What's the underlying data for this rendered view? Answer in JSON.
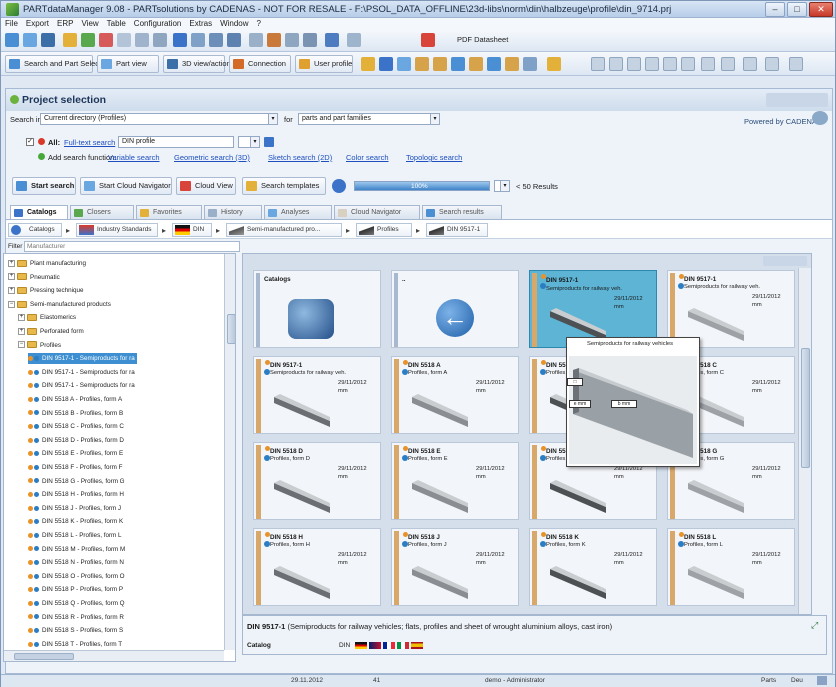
{
  "window": {
    "title": "PARTdataManager 9.08 - PARTsolutions by CADENAS - NOT FOR RESALE - F:\\PSOL_DATA_OFFLINE\\23d-libs\\norm\\din\\halbzeuge\\profile\\din_9714.prj",
    "min": "–",
    "max": "□",
    "close": "✕"
  },
  "menu": [
    "File",
    "Export",
    "ERP",
    "View",
    "Table",
    "Configuration",
    "Extras",
    "Window",
    "?"
  ],
  "toolbar2": {
    "selection": "Search and Part Selection",
    "part_view": "Part view",
    "3d_view": "3D view/action",
    "connection": "Connection",
    "user_profile": "User profile",
    "pdf": "PDF Datasheet"
  },
  "project": {
    "title": "Project selection",
    "search_in_label": "Search in",
    "search_in_value": "Current directory (Profiles)",
    "for_label": "for",
    "for_value": "parts and part families",
    "all_label": "All:",
    "fulltext_link": "Full-text search",
    "fulltext_value": "DIN profile",
    "add_search_label": "Add search function:",
    "functions": [
      "Variable search",
      "Geometric search (3D)",
      "Sketch search (2D)",
      "Color search",
      "Topologic search"
    ],
    "start_search": "Start search",
    "start_cloud": "Start Cloud Navigator",
    "cloud_view": "Cloud View",
    "search_templates": "Search templates",
    "progress_text": "100%",
    "results": "< 50 Results",
    "powerdriven": "Powered by CADENAS"
  },
  "tabs": [
    "Catalogs",
    "Closers",
    "Favorites",
    "History",
    "Analyses",
    "Cloud Navigator",
    "Search results"
  ],
  "breadcrumb": [
    "Catalogs",
    "Industry Standards",
    "DIN",
    "Semi-manufactured pro...",
    "Profiles",
    "DIN 9517-1"
  ],
  "filter": {
    "label": "Filter",
    "placeholder": "Manufacturer"
  },
  "tree": [
    {
      "label": "Plant manufacturing",
      "level": 1,
      "type": "folder",
      "exp": "+"
    },
    {
      "label": "Pneumatic",
      "level": 1,
      "type": "folder",
      "exp": "+"
    },
    {
      "label": "Pressing technique",
      "level": 1,
      "type": "folder",
      "exp": "+"
    },
    {
      "label": "Semi-manufactured products",
      "level": 1,
      "type": "folder",
      "exp": "−"
    },
    {
      "label": "Elastomerics",
      "level": 2,
      "type": "folder",
      "exp": "+"
    },
    {
      "label": "Perforated form",
      "level": 2,
      "type": "folder",
      "exp": "+"
    },
    {
      "label": "Profiles",
      "level": 2,
      "type": "folder",
      "exp": "−"
    },
    {
      "label": "DIN 9517-1 - Semiproducts for ra",
      "level": 3,
      "type": "part",
      "selected": true
    },
    {
      "label": "DIN 9517-1 - Semiproducts for ra",
      "level": 3,
      "type": "part"
    },
    {
      "label": "DIN 9517-1 - Semiproducts for ra",
      "level": 3,
      "type": "part"
    },
    {
      "label": "DIN 5518 A - Profiles, form A",
      "level": 3,
      "type": "part"
    },
    {
      "label": "DIN 5518 B - Profiles, form B",
      "level": 3,
      "type": "part"
    },
    {
      "label": "DIN 5518 C - Profiles, form C",
      "level": 3,
      "type": "part"
    },
    {
      "label": "DIN 5518 D - Profiles, form D",
      "level": 3,
      "type": "part"
    },
    {
      "label": "DIN 5518 E - Profiles, form E",
      "level": 3,
      "type": "part"
    },
    {
      "label": "DIN 5518 F - Profiles, form F",
      "level": 3,
      "type": "part"
    },
    {
      "label": "DIN 5518 G - Profiles, form G",
      "level": 3,
      "type": "part"
    },
    {
      "label": "DIN 5518 H - Profiles, form H",
      "level": 3,
      "type": "part"
    },
    {
      "label": "DIN 5518 J - Profiles, form J",
      "level": 3,
      "type": "part"
    },
    {
      "label": "DIN 5518 K - Profiles, form K",
      "level": 3,
      "type": "part"
    },
    {
      "label": "DIN 5518 L - Profiles, form L",
      "level": 3,
      "type": "part"
    },
    {
      "label": "DIN 5518 M - Profiles, form M",
      "level": 3,
      "type": "part"
    },
    {
      "label": "DIN 5518 N - Profiles, form N",
      "level": 3,
      "type": "part"
    },
    {
      "label": "DIN 5518 O - Profiles, form O",
      "level": 3,
      "type": "part"
    },
    {
      "label": "DIN 5518 P - Profiles, form P",
      "level": 3,
      "type": "part"
    },
    {
      "label": "DIN 5518 Q - Profiles, form Q",
      "level": 3,
      "type": "part"
    },
    {
      "label": "DIN 5518 R - Profiles, form R",
      "level": 3,
      "type": "part"
    },
    {
      "label": "DIN 5518 S - Profiles, form S",
      "level": 3,
      "type": "part"
    },
    {
      "label": "DIN 5518 T - Profiles, form T",
      "level": 3,
      "type": "part"
    }
  ],
  "cards": [
    {
      "title": "Catalogs",
      "desc": "",
      "date": "",
      "unit": "",
      "kind": "folder"
    },
    {
      "title": "..",
      "desc": "",
      "date": "",
      "unit": "",
      "kind": "back"
    },
    {
      "title": "DIN 9517-1",
      "desc": "Semiproducts for railway veh.",
      "date": "29/11/2012",
      "unit": "mm",
      "kind": "part",
      "selected": true
    },
    {
      "title": "DIN 9517-1",
      "desc": "Semiproducts for railway veh.",
      "date": "29/11/2012",
      "unit": "mm",
      "kind": "part"
    },
    {
      "title": "DIN 9517-1",
      "desc": "Semiproducts for railway veh.",
      "date": "29/11/2012",
      "unit": "mm",
      "kind": "part"
    },
    {
      "title": "DIN 5518 A",
      "desc": "Profiles, form A",
      "date": "29/11/2012",
      "unit": "mm",
      "kind": "part"
    },
    {
      "title": "DIN 5518 B",
      "desc": "Profiles, form B",
      "date": "29/11/2012",
      "unit": "mm",
      "kind": "part"
    },
    {
      "title": "DIN 5518 C",
      "desc": "Profiles, form C",
      "date": "29/11/2012",
      "unit": "mm",
      "kind": "part"
    },
    {
      "title": "DIN 5518 D",
      "desc": "Profiles, form D",
      "date": "29/11/2012",
      "unit": "mm",
      "kind": "part"
    },
    {
      "title": "DIN 5518 E",
      "desc": "Profiles, form E",
      "date": "29/11/2012",
      "unit": "mm",
      "kind": "part"
    },
    {
      "title": "DIN 5518 F",
      "desc": "Profiles, form F",
      "date": "29/11/2012",
      "unit": "mm",
      "kind": "part"
    },
    {
      "title": "DIN 5518 G",
      "desc": "Profiles, form G",
      "date": "29/11/2012",
      "unit": "mm",
      "kind": "part"
    },
    {
      "title": "DIN 5518 H",
      "desc": "Profiles, form H",
      "date": "29/11/2012",
      "unit": "mm",
      "kind": "part"
    },
    {
      "title": "DIN 5518 J",
      "desc": "Profiles, form J",
      "date": "29/11/2012",
      "unit": "mm",
      "kind": "part"
    },
    {
      "title": "DIN 5518 K",
      "desc": "Profiles, form K",
      "date": "29/11/2012",
      "unit": "mm",
      "kind": "part"
    },
    {
      "title": "DIN 5518 L",
      "desc": "Profiles, form L",
      "date": "29/11/2012",
      "unit": "mm",
      "kind": "part"
    }
  ],
  "tooltip": {
    "caption": "Semiproducts for railway vehicles",
    "dim1": "e mm",
    "dim2": "b mm"
  },
  "info": {
    "title": "DIN 9517-1",
    "text": "(Semiproducts for railway vehicles; flats, profiles and sheet of wrought aluminium alloys, cast iron)",
    "catalog_label": "Catalog",
    "catalog_value": "DIN"
  },
  "status": {
    "date": "29.11.2012",
    "num": "41",
    "user": "demo - Administrator",
    "mode": "Parts",
    "lang": "Deu"
  },
  "colors": {
    "accent": "#5db4d5",
    "titlebar": "#b7cde8",
    "folder": "#e8b84a"
  }
}
